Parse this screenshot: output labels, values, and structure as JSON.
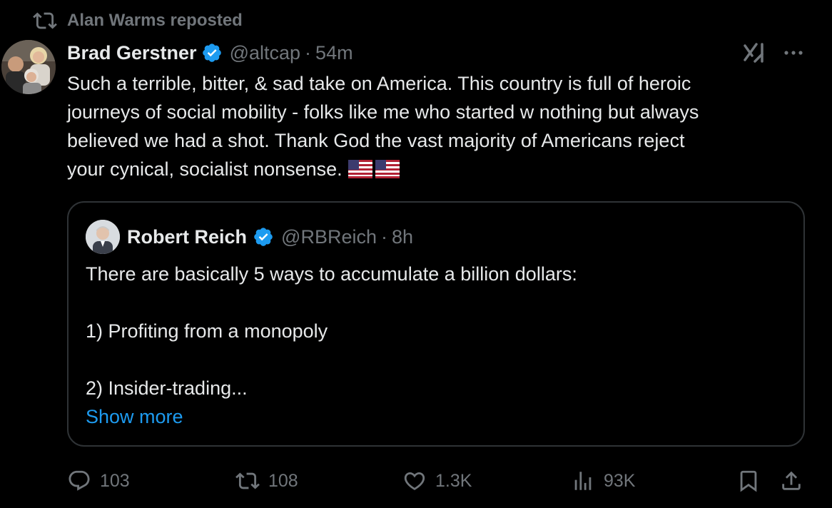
{
  "repost": {
    "label": "Alan Warms reposted",
    "icon": "repost-icon"
  },
  "post": {
    "author_name": "Brad Gerstner",
    "handle": "@altcap",
    "separator": "·",
    "time": "54m",
    "text_lines": [
      "Such a terrible, bitter, & sad take on America.  This country is full of heroic",
      "journeys of social mobility - folks like me who started w nothing but always",
      "believed we had a shot. Thank God the vast majority of Americans reject",
      "your cynical, socialist nonsense."
    ],
    "emoji": [
      "us-flag",
      "us-flag"
    ]
  },
  "quote": {
    "author_name": "Robert Reich",
    "handle": "@RBReich",
    "separator": "·",
    "time": "8h",
    "paragraphs": [
      "There are basically 5 ways to accumulate a billion dollars:",
      "1) Profiting from a monopoly",
      "2) Insider-trading..."
    ],
    "show_more": "Show more"
  },
  "actions": {
    "replies": "103",
    "reposts": "108",
    "likes": "1.3K",
    "views": "93K"
  },
  "colors": {
    "background": "#000000",
    "text": "#e7e9ea",
    "muted": "#71767b",
    "accent": "#1d9bf0",
    "border": "#2f3336"
  }
}
